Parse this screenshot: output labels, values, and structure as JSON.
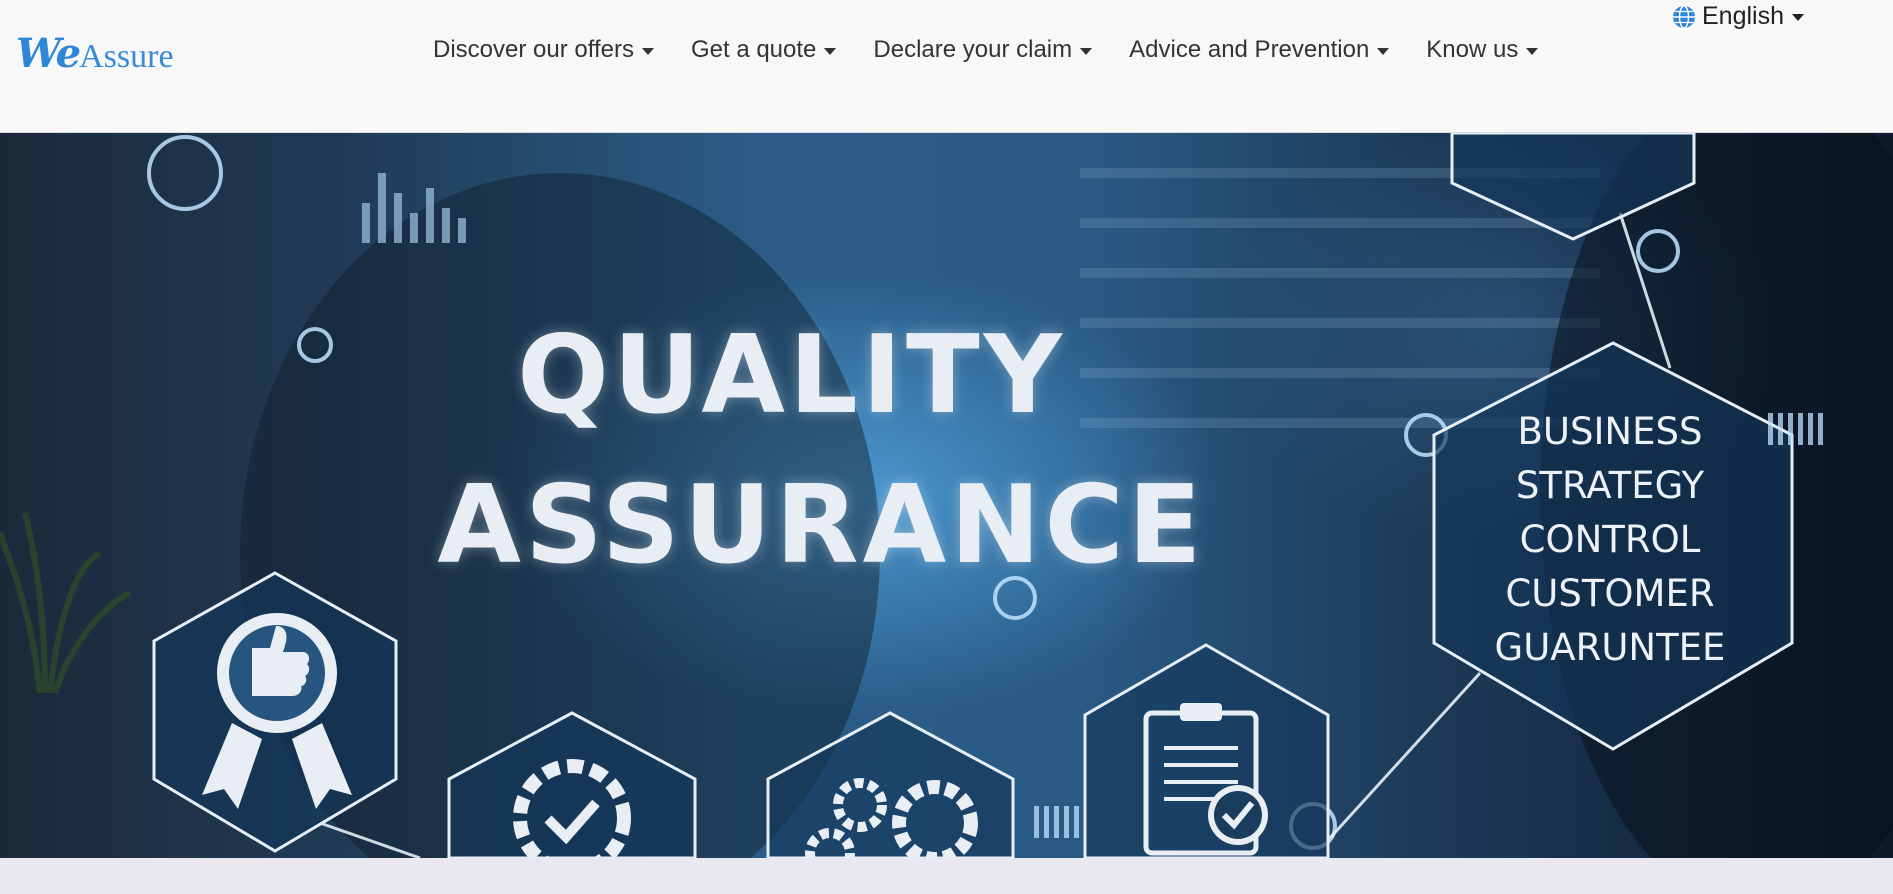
{
  "header": {
    "logo": {
      "part1": "We",
      "part2": "Assure"
    },
    "nav": [
      {
        "label": "Discover our offers"
      },
      {
        "label": "Get a quote"
      },
      {
        "label": "Declare your claim"
      },
      {
        "label": "Advice and Prevention"
      },
      {
        "label": "Know us"
      }
    ],
    "language": {
      "label": "English",
      "icon": "globe-icon"
    }
  },
  "hero": {
    "line1": "QUALITY",
    "line2": "ASSURANCE",
    "side_list": [
      "BUSINESS",
      "STRATEGY",
      "CONTROL",
      "CUSTOMER",
      "GUARUNTEE"
    ],
    "icons": [
      "thumbs-up-award-icon",
      "gear-check-icon",
      "gears-icon",
      "clipboard-check-icon"
    ]
  },
  "colors": {
    "accent": "#2f86d6",
    "header_bg": "#f8f8f8",
    "hero_dark": "#0d1a2c",
    "hero_light": "#55aae6"
  }
}
